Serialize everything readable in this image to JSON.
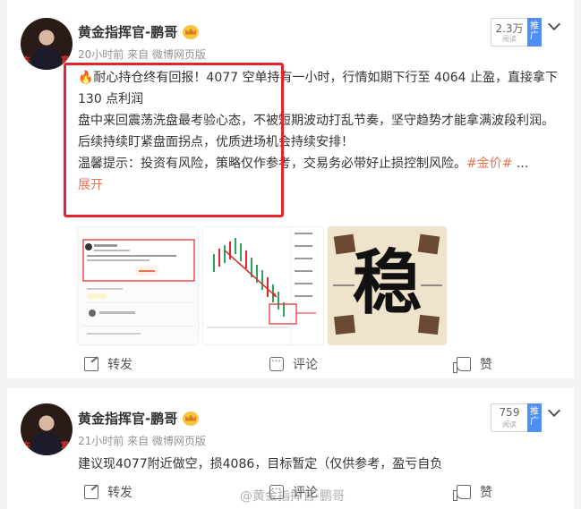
{
  "posts": [
    {
      "author": "黄金指挥官-鹏哥",
      "meta": "20小时前 来自 微博网页版",
      "views": {
        "count": "2.3万",
        "label": "阅读",
        "promo": "推广"
      },
      "lines": [
        "🔥耐心持仓终有回报！4077 空单持有一小时，行情如期下行至 4064 止盈，直接拿下 130 点利润",
        "盘中来回震荡洗盘最考验心态，不被短期波动打乱节奏，坚守趋势才能拿满波段利润。",
        "后续持续盯紧盘面拐点，优质进场机会持续安排！"
      ],
      "tip_text": "温馨提示：投资有风险，策略仅作参考，交易务必带好止损控制风险。",
      "hashtag": "#金价#",
      "ellipsis": " ...",
      "expand": "展开",
      "images": [
        "screenshot",
        "kline-chart",
        "stable-calligraphy"
      ],
      "calligraphy": "稳",
      "actions": {
        "forward": "转发",
        "comment": "评论",
        "like": "赞"
      }
    },
    {
      "author": "黄金指挥官-鹏哥",
      "meta": "21小时前 来自 微博网页版",
      "views": {
        "count": "759",
        "label": "阅读",
        "promo": "推广"
      },
      "text": "建议现4077附近做空，损4086，目标暂定（仅供参考，盈亏自负",
      "actions": {
        "forward": "转发",
        "comment": "评论",
        "like": "赞"
      }
    }
  ],
  "watermark": "@黄金指挥官-鹏哥",
  "colors": {
    "accent": "#eb7350",
    "highlight": "#e0262c",
    "promo": "#4f8ef7"
  }
}
